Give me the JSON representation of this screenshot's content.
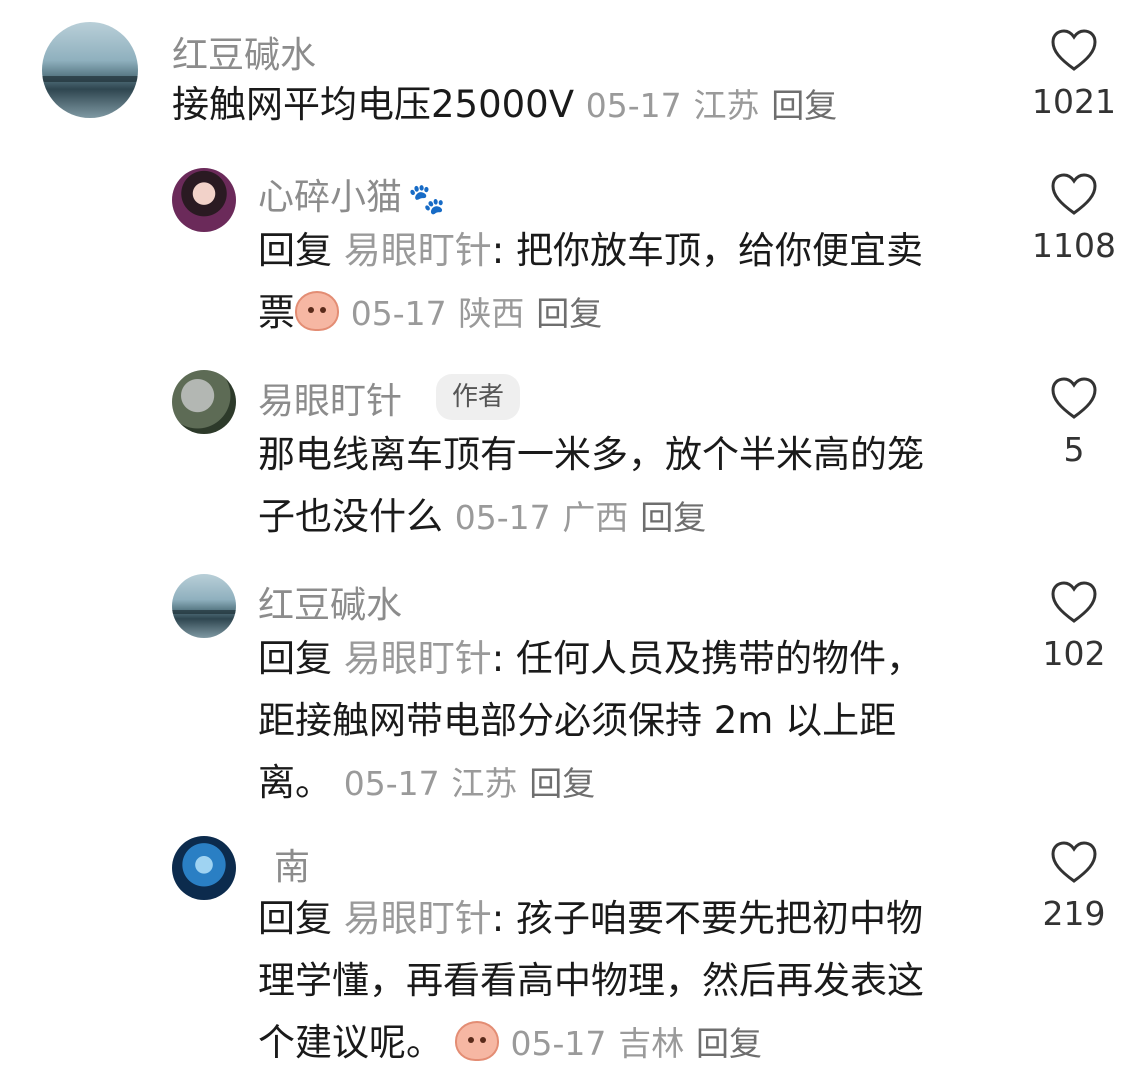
{
  "comments": [
    {
      "name": "红豆碱水",
      "text_main": "接触网平均电压25000V",
      "date": "05-17",
      "location": "江苏",
      "reply_label": "回复",
      "likes": "1021"
    },
    {
      "name": "心碎小猫",
      "reply_prefix": "回复",
      "reply_to": "易眼盯针",
      "text_line1": ": 把你放车顶，给你便宜卖",
      "text_line2": "票",
      "date": "05-17",
      "location": "陕西",
      "reply_label": "回复",
      "likes": "1108"
    },
    {
      "name": "易眼盯针",
      "badge": "作者",
      "text_line1": "那电线离车顶有一米多，放个半米高的笼",
      "text_line2": "子也没什么",
      "date": "05-17",
      "location": "广西",
      "reply_label": "回复",
      "likes": "5"
    },
    {
      "name": "红豆碱水",
      "reply_prefix": "回复",
      "reply_to": "易眼盯针",
      "text_line1": ": 任何人员及携带的物件，",
      "text_line2": "距接触网带电部分必须保持 2m 以上距",
      "text_line3": "离。",
      "date": "05-17",
      "location": "江苏",
      "reply_label": "回复",
      "likes": "102"
    },
    {
      "name": "南",
      "reply_prefix": "回复",
      "reply_to": "易眼盯针",
      "text_line1": ": 孩子咱要不要先把初中物",
      "text_line2": "理学懂，再看看高中物理，然后再发表这",
      "text_line3": "个建议呢。",
      "date": "05-17",
      "location": "吉林",
      "reply_label": "回复",
      "likes": "219"
    }
  ]
}
